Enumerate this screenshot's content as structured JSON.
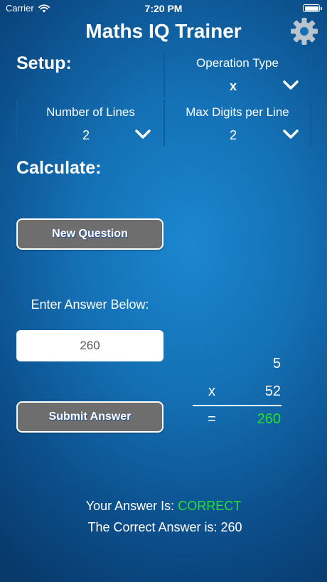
{
  "status_bar": {
    "carrier": "Carrier",
    "time": "7:20 PM"
  },
  "app": {
    "title": "Maths IQ Trainer"
  },
  "setup": {
    "heading": "Setup:",
    "operation_type": {
      "label": "Operation Type",
      "value": "x"
    },
    "number_of_lines": {
      "label": "Number of Lines",
      "value": "2"
    },
    "max_digits": {
      "label": "Max Digits per Line",
      "value": "2"
    }
  },
  "calculate": {
    "heading": "Calculate:",
    "new_question_label": "New Question",
    "enter_answer_label": "Enter Answer Below:",
    "answer_value": "260",
    "submit_label": "Submit Answer"
  },
  "problem": {
    "line1": "5",
    "operator": "x",
    "line2": "52",
    "equals": "=",
    "result": "260"
  },
  "result": {
    "your_answer_prefix": "Your Answer Is:",
    "your_answer_status": "CORRECT",
    "correct_answer_text": "The Correct Answer is: 260"
  },
  "colors": {
    "correct": "#22e22e",
    "button_bg": "#6e6e6e",
    "background": "#1470b4"
  },
  "icons": {
    "wifi": "wifi-icon",
    "battery": "battery-icon",
    "settings": "gear-icon",
    "chevron": "chevron-down-icon"
  }
}
